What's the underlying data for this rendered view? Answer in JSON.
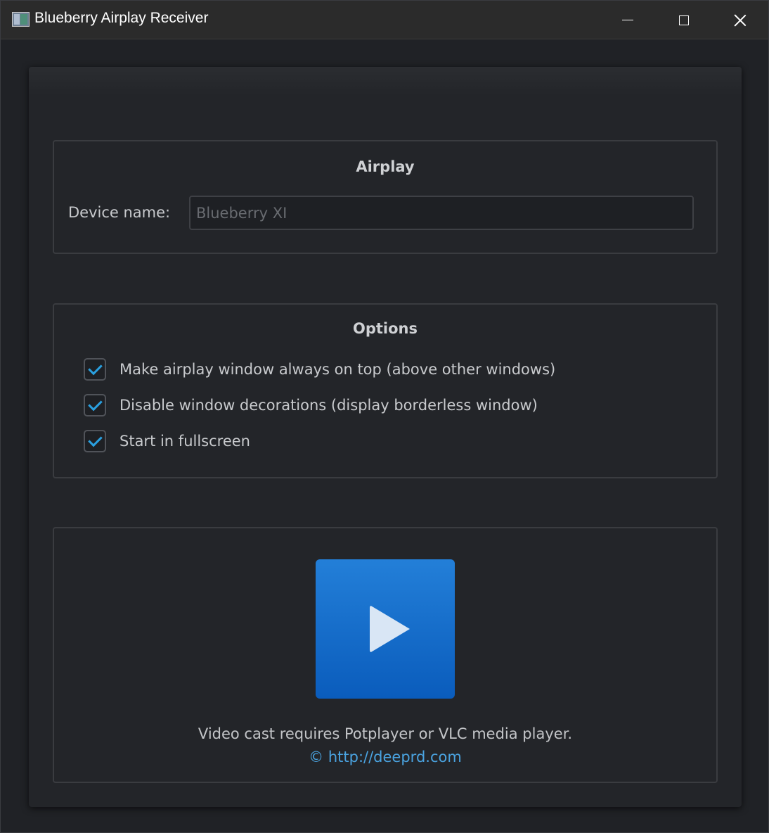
{
  "window": {
    "title": "Blueberry Airplay Receiver"
  },
  "airplay": {
    "title": "Airplay",
    "device_label": "Device name:",
    "device_placeholder": "Blueberry XI"
  },
  "options": {
    "title": "Options",
    "items": [
      {
        "label": "Make airplay window always on top (above other windows)",
        "checked": true
      },
      {
        "label": "Disable window decorations (display borderless window)",
        "checked": true
      },
      {
        "label": "Start in fullscreen",
        "checked": true
      }
    ]
  },
  "play": {
    "note": "Video cast requires Potplayer or VLC media player.",
    "link": "© http://deeprd.com"
  },
  "colors": {
    "accent": "#2aa0e0",
    "play_button": "#1670cc"
  },
  "icons": [
    "app-icon",
    "minimize-icon",
    "maximize-icon",
    "close-icon",
    "play-icon",
    "checkmark-icon"
  ]
}
